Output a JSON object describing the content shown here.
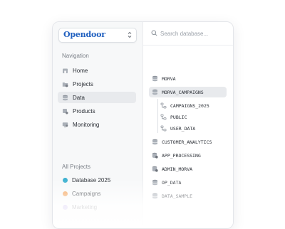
{
  "org": {
    "name": "Opendoor"
  },
  "nav": {
    "title": "Navigation",
    "items": [
      {
        "label": "Home",
        "icon": "home-icon"
      },
      {
        "label": "Projects",
        "icon": "folder-icon"
      },
      {
        "label": "Data",
        "icon": "database-icon",
        "active": true
      },
      {
        "label": "Products",
        "icon": "products-icon"
      },
      {
        "label": "Monitoring",
        "icon": "monitor-icon"
      }
    ]
  },
  "projects": {
    "title": "All Projects",
    "items": [
      {
        "label": "Database 2025",
        "color": "#3ab0d0"
      },
      {
        "label": "Campaigns",
        "color": "#f2994a"
      },
      {
        "label": "Marketing",
        "color": "#a68ee6"
      }
    ]
  },
  "search": {
    "placeholder": "Search database..."
  },
  "databases": [
    {
      "name": "MORVA"
    },
    {
      "name": "MORVA_CAMPAIGNS",
      "active": true,
      "children": [
        "CAMPAIGNS_2025",
        "PUBLIC",
        "USER_DATA"
      ]
    },
    {
      "name": "CUSTOMER_ANALYTICS"
    },
    {
      "name": "APP_PROCESSING"
    },
    {
      "name": "ADMIN_MORVA"
    },
    {
      "name": "OP_DATA"
    },
    {
      "name": "DATA_SAMPLE"
    }
  ],
  "colors": {
    "brand": "#1f5fbf",
    "active_bg": "#e8eaed",
    "text": "#2a2e35",
    "muted": "#7b8088"
  }
}
